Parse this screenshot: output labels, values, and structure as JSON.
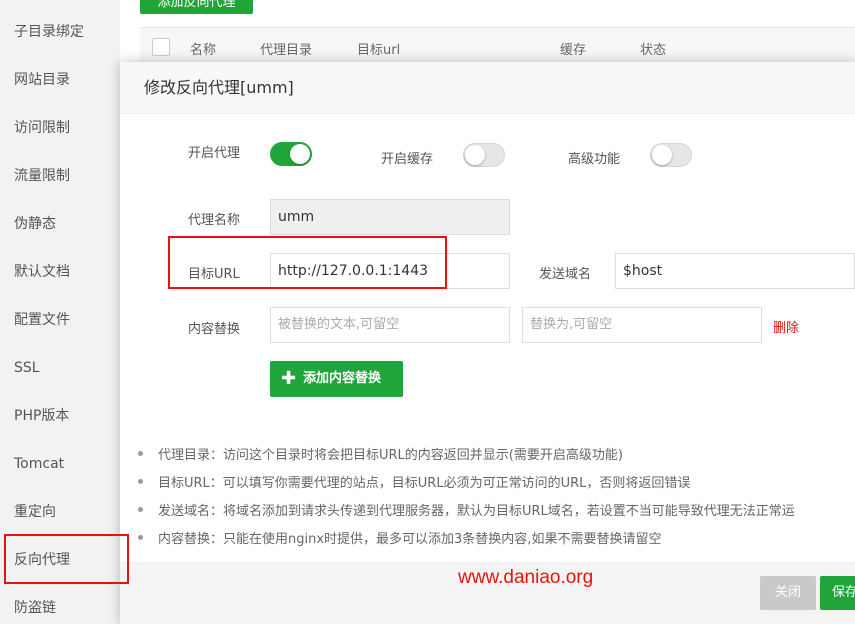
{
  "sidebar": {
    "items": [
      {
        "label": "子目录绑定"
      },
      {
        "label": "网站目录"
      },
      {
        "label": "访问限制"
      },
      {
        "label": "流量限制"
      },
      {
        "label": "伪静态"
      },
      {
        "label": "默认文档"
      },
      {
        "label": "配置文件"
      },
      {
        "label": "SSL"
      },
      {
        "label": "PHP版本"
      },
      {
        "label": "Tomcat"
      },
      {
        "label": "重定向"
      },
      {
        "label": "反向代理"
      },
      {
        "label": "防盗链"
      }
    ],
    "active": "反向代理"
  },
  "background": {
    "add_button_label": "添加反向代理",
    "table_headers": [
      "名称",
      "代理目录",
      "目标url",
      "缓存",
      "状态"
    ]
  },
  "dialog": {
    "title": "修改反向代理[umm]",
    "toggles": {
      "proxy_label": "开启代理",
      "proxy_on": true,
      "cache_label": "开启缓存",
      "cache_on": false,
      "advanced_label": "高级功能",
      "advanced_on": false
    },
    "proxy_name_label": "代理名称",
    "proxy_name_value": "umm",
    "target_url_label": "目标URL",
    "target_url_value": "http://127.0.0.1:1443",
    "send_domain_label": "发送域名",
    "send_domain_value": "$host",
    "content_replace_label": "内容替换",
    "replace_from_placeholder": "被替换的文本,可留空",
    "replace_to_placeholder": "替换为,可留空",
    "delete_label": "删除",
    "add_replace_button": "添加内容替换",
    "notes": [
      "代理目录：访问这个目录时将会把目标URL的内容返回并显示(需要开启高级功能)",
      "目标URL：可以填写你需要代理的站点，目标URL必须为可正常访问的URL，否则将返回错误",
      "发送域名：将域名添加到请求头传递到代理服务器，默认为目标URL域名，若设置不当可能导致代理无法正常运",
      "内容替换：只能在使用nginx时提供，最多可以添加3条替换内容,如果不需要替换请留空"
    ],
    "close_button": "关闭",
    "save_button": "保存"
  },
  "watermark": "www.daniao.org",
  "colors": {
    "accent_green": "#20a53a",
    "highlight_red": "#e8130b"
  }
}
